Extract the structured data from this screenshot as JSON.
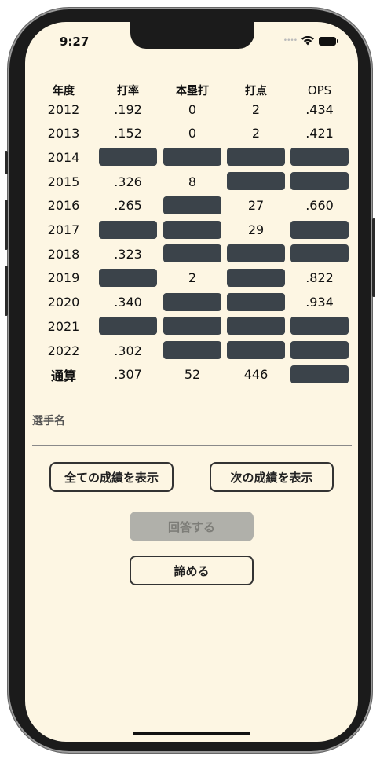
{
  "status_bar": {
    "time": "9:27",
    "signal": "••••"
  },
  "headers": [
    "年度",
    "打率",
    "本塁打",
    "打点",
    "OPS"
  ],
  "rows": [
    {
      "year": "2012",
      "avg": ".192",
      "hr": "0",
      "rbi": "2",
      "ops": ".434"
    },
    {
      "year": "2013",
      "avg": ".152",
      "hr": "0",
      "rbi": "2",
      "ops": ".421"
    },
    {
      "year": "2014",
      "avg": null,
      "hr": null,
      "rbi": null,
      "ops": null
    },
    {
      "year": "2015",
      "avg": ".326",
      "hr": "8",
      "rbi": null,
      "ops": null
    },
    {
      "year": "2016",
      "avg": ".265",
      "hr": null,
      "rbi": "27",
      "ops": ".660"
    },
    {
      "year": "2017",
      "avg": null,
      "hr": null,
      "rbi": "29",
      "ops": null
    },
    {
      "year": "2018",
      "avg": ".323",
      "hr": null,
      "rbi": null,
      "ops": null
    },
    {
      "year": "2019",
      "avg": null,
      "hr": "2",
      "rbi": null,
      "ops": ".822"
    },
    {
      "year": "2020",
      "avg": ".340",
      "hr": null,
      "rbi": null,
      "ops": ".934"
    },
    {
      "year": "2021",
      "avg": null,
      "hr": null,
      "rbi": null,
      "ops": null
    },
    {
      "year": "2022",
      "avg": ".302",
      "hr": null,
      "rbi": null,
      "ops": null
    },
    {
      "year": "通算",
      "avg": ".307",
      "hr": "52",
      "rbi": "446",
      "ops": null
    }
  ],
  "player_field": {
    "label": "選手名",
    "value": ""
  },
  "buttons": {
    "show_all": "全ての成績を表示",
    "show_next": "次の成績を表示",
    "answer": "回答する",
    "give_up": "諦める"
  },
  "colors": {
    "background": "#fdf6e3",
    "mask": "#3b434a",
    "disabled_button": "#b0b0aa"
  }
}
